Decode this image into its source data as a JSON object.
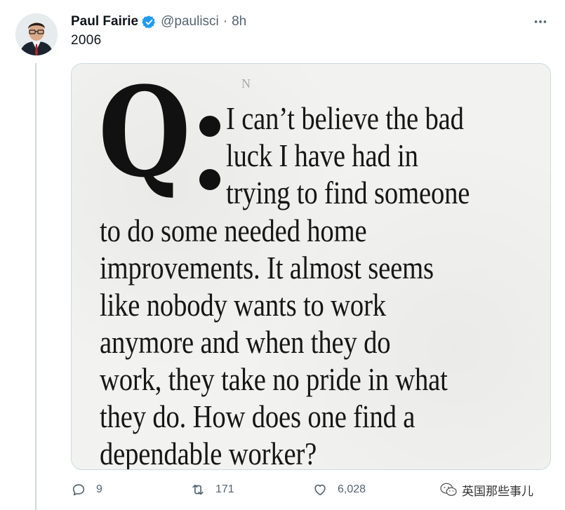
{
  "tweet": {
    "author": {
      "name": "Paul Fairie",
      "handle": "@paulisci",
      "separator": "·",
      "time": "8h",
      "verified": true,
      "avatar_icon": "profile-photo"
    },
    "text": "2006",
    "media": {
      "big_letter": "Q",
      "lines": [
        "I can’t believe the bad",
        "luck I have had in",
        "trying to find someone",
        "to do some needed home",
        "improvements. It almost seems",
        "like nobody wants to work",
        "anymore and when they do",
        "work, they take no pride in what",
        "they do. How does one find a",
        "dependable worker?"
      ],
      "corner_mark": "N"
    },
    "actions": {
      "reply_count": "9",
      "retweet_count": "171",
      "like_count": "6,028"
    }
  },
  "watermark": {
    "text": "英国那些事儿",
    "icon": "wechat-icon"
  },
  "colors": {
    "text_primary": "#0f1419",
    "text_secondary": "#536471",
    "verified_blue": "#1d9bf0",
    "border": "#cfd9de"
  }
}
